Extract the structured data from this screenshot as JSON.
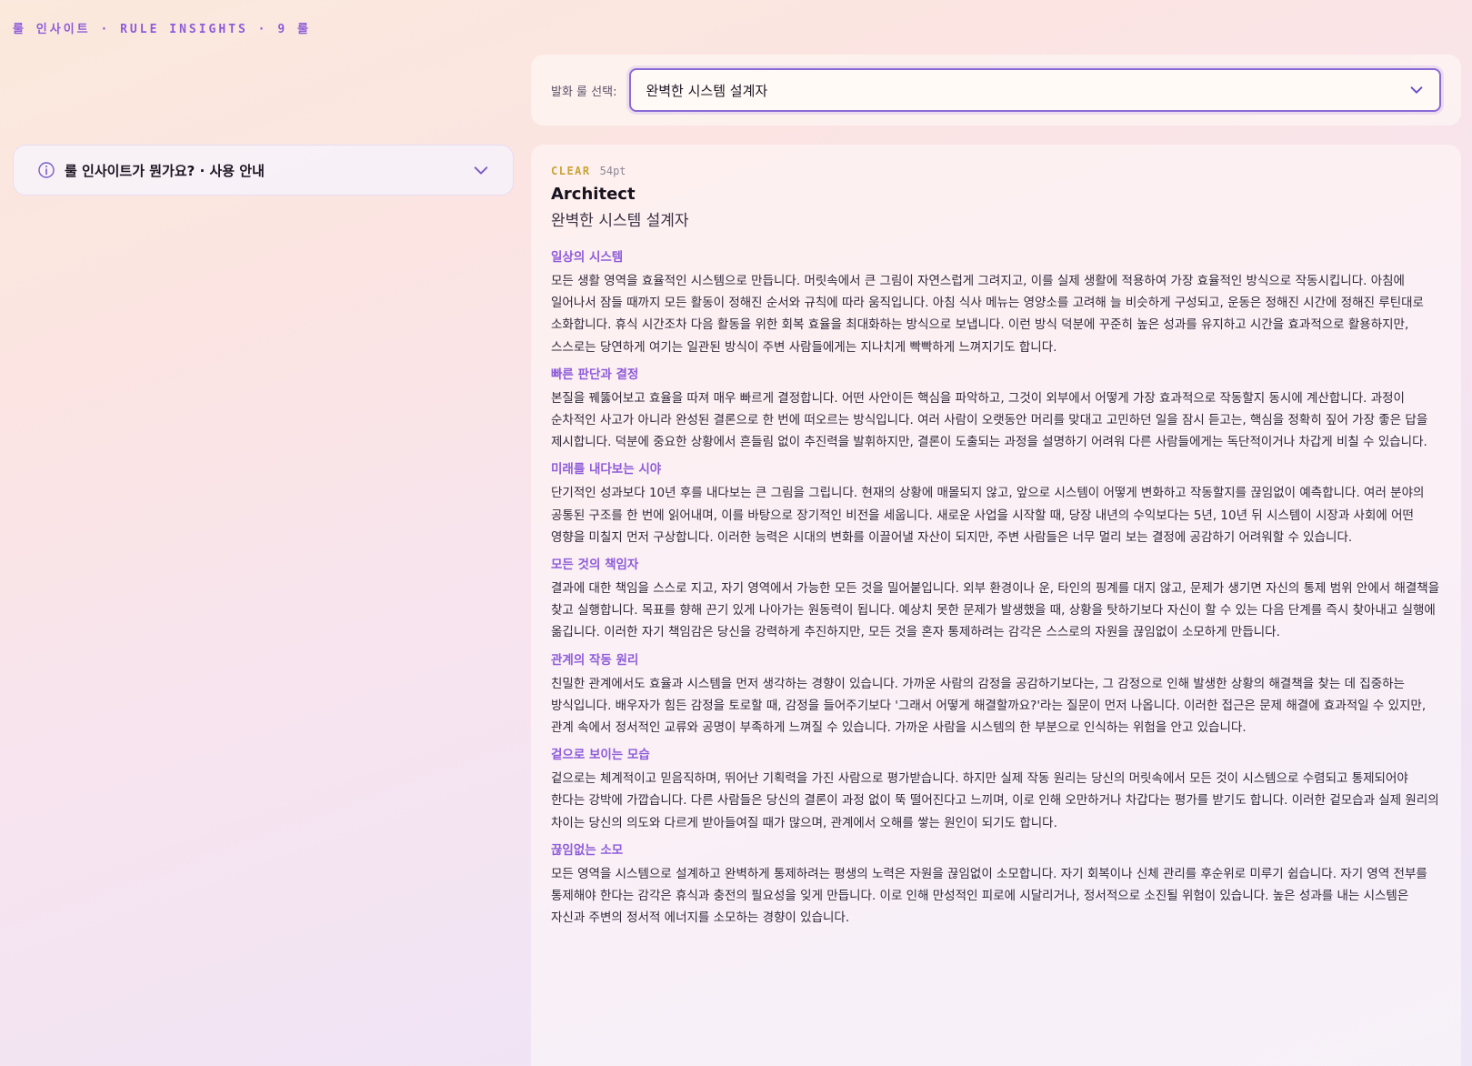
{
  "header": {
    "label": "룰 인사이트 · RULE INSIGHTS · 9 룰"
  },
  "selector": {
    "label": "발화 룰 선택:",
    "value": "완벽한 시스템 설계자"
  },
  "info": {
    "title": "룰 인사이트가 뭔가요? · 사용 안내"
  },
  "rule": {
    "rating_word": "CLEAR",
    "rating_score": "54pt",
    "name_en": "Architect",
    "name_ko": "완벽한 시스템 설계자",
    "sections": [
      {
        "title": "일상의 시스템",
        "body": "모든 생활 영역을 효율적인 시스템으로 만듭니다. 머릿속에서 큰 그림이 자연스럽게 그려지고, 이를 실제 생활에 적용하여 가장 효율적인 방식으로 작동시킵니다. 아침에 일어나서 잠들 때까지 모든 활동이 정해진 순서와 규칙에 따라 움직입니다. 아침 식사 메뉴는 영양소를 고려해 늘 비슷하게 구성되고, 운동은 정해진 시간에 정해진 루틴대로 소화합니다. 휴식 시간조차 다음 활동을 위한 회복 효율을 최대화하는 방식으로 보냅니다. 이런 방식 덕분에 꾸준히 높은 성과를 유지하고 시간을 효과적으로 활용하지만, 스스로는 당연하게 여기는 일관된 방식이 주변 사람들에게는 지나치게 빡빡하게 느껴지기도 합니다."
      },
      {
        "title": "빠른 판단과 결정",
        "body": "본질을 꿰뚫어보고 효율을 따져 매우 빠르게 결정합니다. 어떤 사안이든 핵심을 파악하고, 그것이 외부에서 어떻게 가장 효과적으로 작동할지 동시에 계산합니다. 과정이 순차적인 사고가 아니라 완성된 결론으로 한 번에 떠오르는 방식입니다. 여러 사람이 오랫동안 머리를 맞대고 고민하던 일을 잠시 듣고는, 핵심을 정확히 짚어 가장 좋은 답을 제시합니다. 덕분에 중요한 상황에서 흔들림 없이 추진력을 발휘하지만, 결론이 도출되는 과정을 설명하기 어려워 다른 사람들에게는 독단적이거나 차갑게 비칠 수 있습니다."
      },
      {
        "title": "미래를 내다보는 시야",
        "body": "단기적인 성과보다 10년 후를 내다보는 큰 그림을 그립니다. 현재의 상황에 매몰되지 않고, 앞으로 시스템이 어떻게 변화하고 작동할지를 끊임없이 예측합니다. 여러 분야의 공통된 구조를 한 번에 읽어내며, 이를 바탕으로 장기적인 비전을 세웁니다. 새로운 사업을 시작할 때, 당장 내년의 수익보다는 5년, 10년 뒤 시스템이 시장과 사회에 어떤 영향을 미칠지 먼저 구상합니다. 이러한 능력은 시대의 변화를 이끌어낼 자산이 되지만, 주변 사람들은 너무 멀리 보는 결정에 공감하기 어려워할 수 있습니다."
      },
      {
        "title": "모든 것의 책임자",
        "body": "결과에 대한 책임을 스스로 지고, 자기 영역에서 가능한 모든 것을 밀어붙입니다. 외부 환경이나 운, 타인의 핑계를 대지 않고, 문제가 생기면 자신의 통제 범위 안에서 해결책을 찾고 실행합니다. 목표를 향해 끈기 있게 나아가는 원동력이 됩니다. 예상치 못한 문제가 발생했을 때, 상황을 탓하기보다 자신이 할 수 있는 다음 단계를 즉시 찾아내고 실행에 옮깁니다. 이러한 자기 책임감은 당신을 강력하게 추진하지만, 모든 것을 혼자 통제하려는 감각은 스스로의 자원을 끊임없이 소모하게 만듭니다."
      },
      {
        "title": "관계의 작동 원리",
        "body": "친밀한 관계에서도 효율과 시스템을 먼저 생각하는 경향이 있습니다. 가까운 사람의 감정을 공감하기보다는, 그 감정으로 인해 발생한 상황의 해결책을 찾는 데 집중하는 방식입니다. 배우자가 힘든 감정을 토로할 때, 감정을 들어주기보다 '그래서 어떻게 해결할까요?'라는 질문이 먼저 나옵니다. 이러한 접근은 문제 해결에 효과적일 수 있지만, 관계 속에서 정서적인 교류와 공명이 부족하게 느껴질 수 있습니다. 가까운 사람을 시스템의 한 부분으로 인식하는 위험을 안고 있습니다."
      },
      {
        "title": "겉으로 보이는 모습",
        "body": "겉으로는 체계적이고 믿음직하며, 뛰어난 기획력을 가진 사람으로 평가받습니다. 하지만 실제 작동 원리는 당신의 머릿속에서 모든 것이 시스템으로 수렴되고 통제되어야 한다는 강박에 가깝습니다. 다른 사람들은 당신의 결론이 과정 없이 뚝 떨어진다고 느끼며, 이로 인해 오만하거나 차갑다는 평가를 받기도 합니다. 이러한 겉모습과 실제 원리의 차이는 당신의 의도와 다르게 받아들여질 때가 많으며, 관계에서 오해를 쌓는 원인이 되기도 합니다."
      },
      {
        "title": "끊임없는 소모",
        "body": "모든 영역을 시스템으로 설계하고 완벽하게 통제하려는 평생의 노력은 자원을 끊임없이 소모합니다. 자기 회복이나 신체 관리를 후순위로 미루기 쉽습니다. 자기 영역 전부를 통제해야 한다는 감각은 휴식과 충전의 필요성을 잊게 만듭니다. 이로 인해 만성적인 피로에 시달리거나, 정서적으로 소진될 위험이 있습니다. 높은 성과를 내는 시스템은 자신과 주변의 정서적 에너지를 소모하는 경향이 있습니다."
      }
    ]
  }
}
